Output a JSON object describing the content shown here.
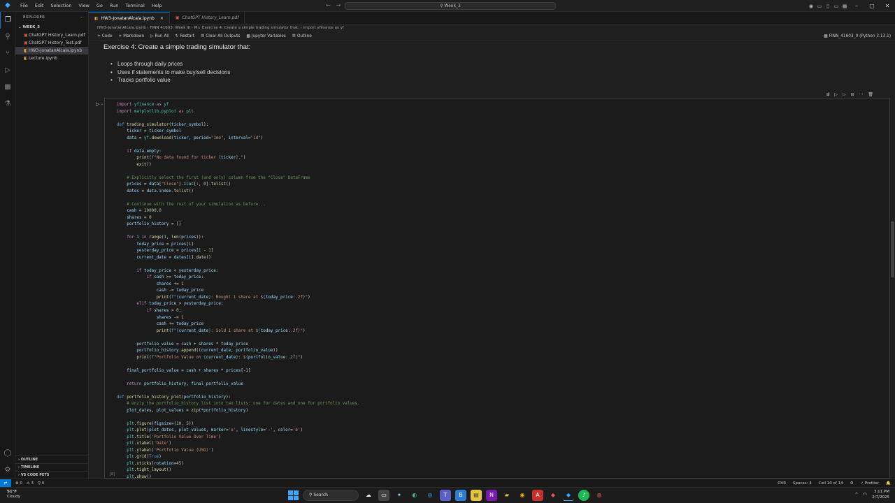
{
  "titlebar": {
    "menus": [
      "File",
      "Edit",
      "Selection",
      "View",
      "Go",
      "Run",
      "Terminal",
      "Help"
    ],
    "command_center": "Week_3"
  },
  "sidebar": {
    "header": "EXPLORER",
    "folder": "WEEK_3",
    "files": [
      {
        "name": "ChatGPT History_Learn.pdf",
        "type": "pdf"
      },
      {
        "name": "ChatGPT History_Test.pdf",
        "type": "pdf"
      },
      {
        "name": "HW3-JonatanAlcala.ipynb",
        "type": "notebook",
        "active": true
      },
      {
        "name": "Lecture.ipynb",
        "type": "notebook"
      }
    ],
    "sections": [
      "OUTLINE",
      "TIMELINE",
      "VS CODE PETS"
    ]
  },
  "tabs": [
    {
      "label": "HW3-JonatanAlcala.ipynb",
      "active": true
    },
    {
      "label": "ChatGPT History_Learn.pdf",
      "active": false
    }
  ],
  "breadcrumb": "HW3-JonatanAlcala.ipynb  ›  FINN 41603: Week III  ›  M↓ Exercise 4: Create a simple trading simulator that:  ›  import yfinance as yf",
  "notebook_toolbar": {
    "code": "+ Code",
    "markdown": "+ Markdown",
    "run_all": "▷ Run All",
    "restart": "↻ Restart",
    "clear_outputs": "☰ Clear All Outputs",
    "variables": "▦ Jupyter Variables",
    "outline": "☰ Outline",
    "kernel": "FINN_41603_0 (Python 3.13.1)"
  },
  "markdown_cell": {
    "title": "Exercise 4: Create a simple trading simulator that:",
    "bullets": [
      "Loops through daily prices",
      "Uses if statements to make buy/sell decisions",
      "Tracks portfolio value"
    ]
  },
  "code_cell": {
    "execution_count": "[8]"
  },
  "statusbar": {
    "errors": "⊗ 0",
    "warnings": "⚠ 3",
    "ports": "⚲ 0",
    "ovr": "OVR",
    "spaces": "Spaces: 4",
    "cell": "Cell 10 of 14",
    "prettier": "✓ Prettier"
  },
  "taskbar": {
    "temp": "51°F",
    "weather": "Cloudy",
    "search": "Search",
    "time": "3:11 PM",
    "date": "2/7/2025"
  },
  "colors": {
    "accent": "#0078d4",
    "keyword": "#c586c0",
    "function": "#dcdcaa",
    "string": "#ce9178",
    "comment": "#6a9955"
  }
}
